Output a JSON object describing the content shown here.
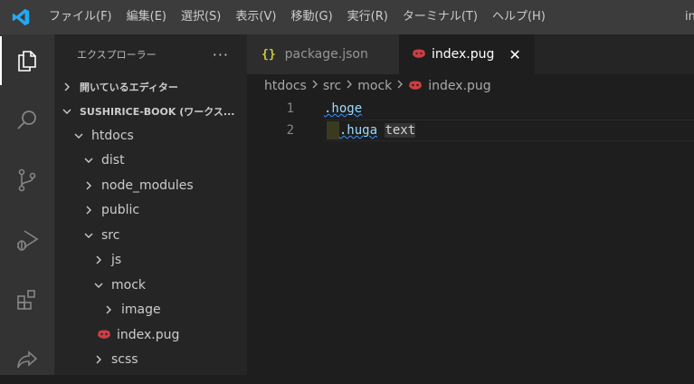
{
  "menu": {
    "items": [
      "ファイル(F)",
      "編集(E)",
      "選択(S)",
      "表示(V)",
      "移動(G)",
      "実行(R)",
      "ターミナル(T)",
      "ヘルプ(H)"
    ],
    "title_fragment": "in"
  },
  "activity_bar": {
    "items": [
      "explorer-icon",
      "search-icon",
      "source-control-icon",
      "run-debug-icon",
      "extensions-icon",
      "live-share-icon"
    ],
    "active_color": "#ffffff"
  },
  "sidebar": {
    "header": "エクスプローラー",
    "more": "···",
    "open_editors": "開いているエディター",
    "workspace": "SUSHIRICE-BOOK (ワークス...",
    "tree": [
      {
        "label": "htdocs",
        "indent": 1,
        "state": "open"
      },
      {
        "label": "dist",
        "indent": 2,
        "state": "open"
      },
      {
        "label": "node_modules",
        "indent": 2,
        "state": "closed"
      },
      {
        "label": "public",
        "indent": 2,
        "state": "closed"
      },
      {
        "label": "src",
        "indent": 2,
        "state": "open"
      },
      {
        "label": "js",
        "indent": 3,
        "state": "closed"
      },
      {
        "label": "mock",
        "indent": 3,
        "state": "open"
      },
      {
        "label": "image",
        "indent": 4,
        "state": "closed"
      },
      {
        "label": "index.pug",
        "indent": 4,
        "state": "file"
      },
      {
        "label": "scss",
        "indent": 3,
        "state": "closed"
      }
    ]
  },
  "tabs": [
    {
      "label": "package.json",
      "icon": "{}",
      "active": false
    },
    {
      "label": "index.pug",
      "active": true,
      "close": "✕"
    }
  ],
  "breadcrumb": {
    "items": [
      "htdocs",
      "src",
      "mock"
    ],
    "file": "index.pug"
  },
  "editor": {
    "lines": [
      {
        "number": "1",
        "cls": ".hoge",
        "text": ""
      },
      {
        "number": "2",
        "cls": ".huga",
        "text": "text"
      }
    ]
  },
  "colors": {
    "accent": "#3794ff",
    "pug": "#cc3e44",
    "json": "#cbcb41"
  }
}
